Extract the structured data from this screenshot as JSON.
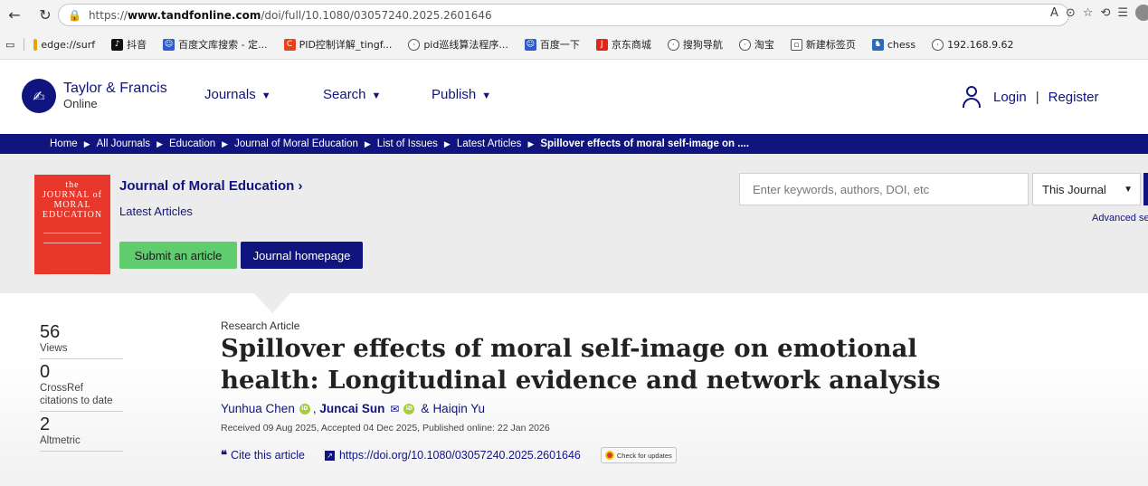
{
  "browser": {
    "url_prefix": "https://",
    "url_domain": "www.tandfonline.com",
    "url_path": "/doi/full/10.1080/03057240.2025.2601646",
    "bookmarks": [
      "edge://surf",
      "抖音",
      "百度文库搜索 - 定...",
      "PID控制详解_tingf...",
      "pid巡线算法程序...",
      "百度一下",
      "京东商城",
      "搜狗导航",
      "淘宝",
      "新建标签页",
      "chess",
      "192.168.9.62"
    ]
  },
  "header": {
    "logo_line1": "Taylor & Francis",
    "logo_line2": "Online",
    "menu": [
      "Journals",
      "Search",
      "Publish"
    ],
    "login": "Login",
    "register": "Register"
  },
  "breadcrumb": [
    "Home",
    "All Journals",
    "Education",
    "Journal of Moral Education",
    "List of Issues",
    "Latest Articles",
    "Spillover effects of moral self-image on ...."
  ],
  "journal": {
    "title": "Journal of Moral Education ›",
    "subtitle": "Latest Articles",
    "submit_label": "Submit an article",
    "homepage_label": "Journal homepage",
    "search_placeholder": "Enter keywords, authors, DOI, etc",
    "scope": "This Journal",
    "advanced": "Advanced se"
  },
  "metrics": [
    {
      "num": "56",
      "label": "Views"
    },
    {
      "num": "0",
      "label": "CrossRef citations to date"
    },
    {
      "num": "2",
      "label": "Altmetric"
    }
  ],
  "article": {
    "type": "Research Article",
    "title": "Spillover effects of moral self-image on emotional health: Longitudinal evidence and network analysis",
    "author1": "Yunhua Chen",
    "author2": "Juncai Sun",
    "author3": "Haiqin Yu",
    "dates": "Received 09 Aug 2025, Accepted 04 Dec 2025, Published online: 22 Jan 2026",
    "cite": "Cite this article",
    "doi": "https://doi.org/10.1080/03057240.2025.2601646",
    "updates": "Check for updates"
  },
  "colors": {
    "brand": "#10147e",
    "submit": "#5fcd6e",
    "cover": "#e8382b"
  }
}
